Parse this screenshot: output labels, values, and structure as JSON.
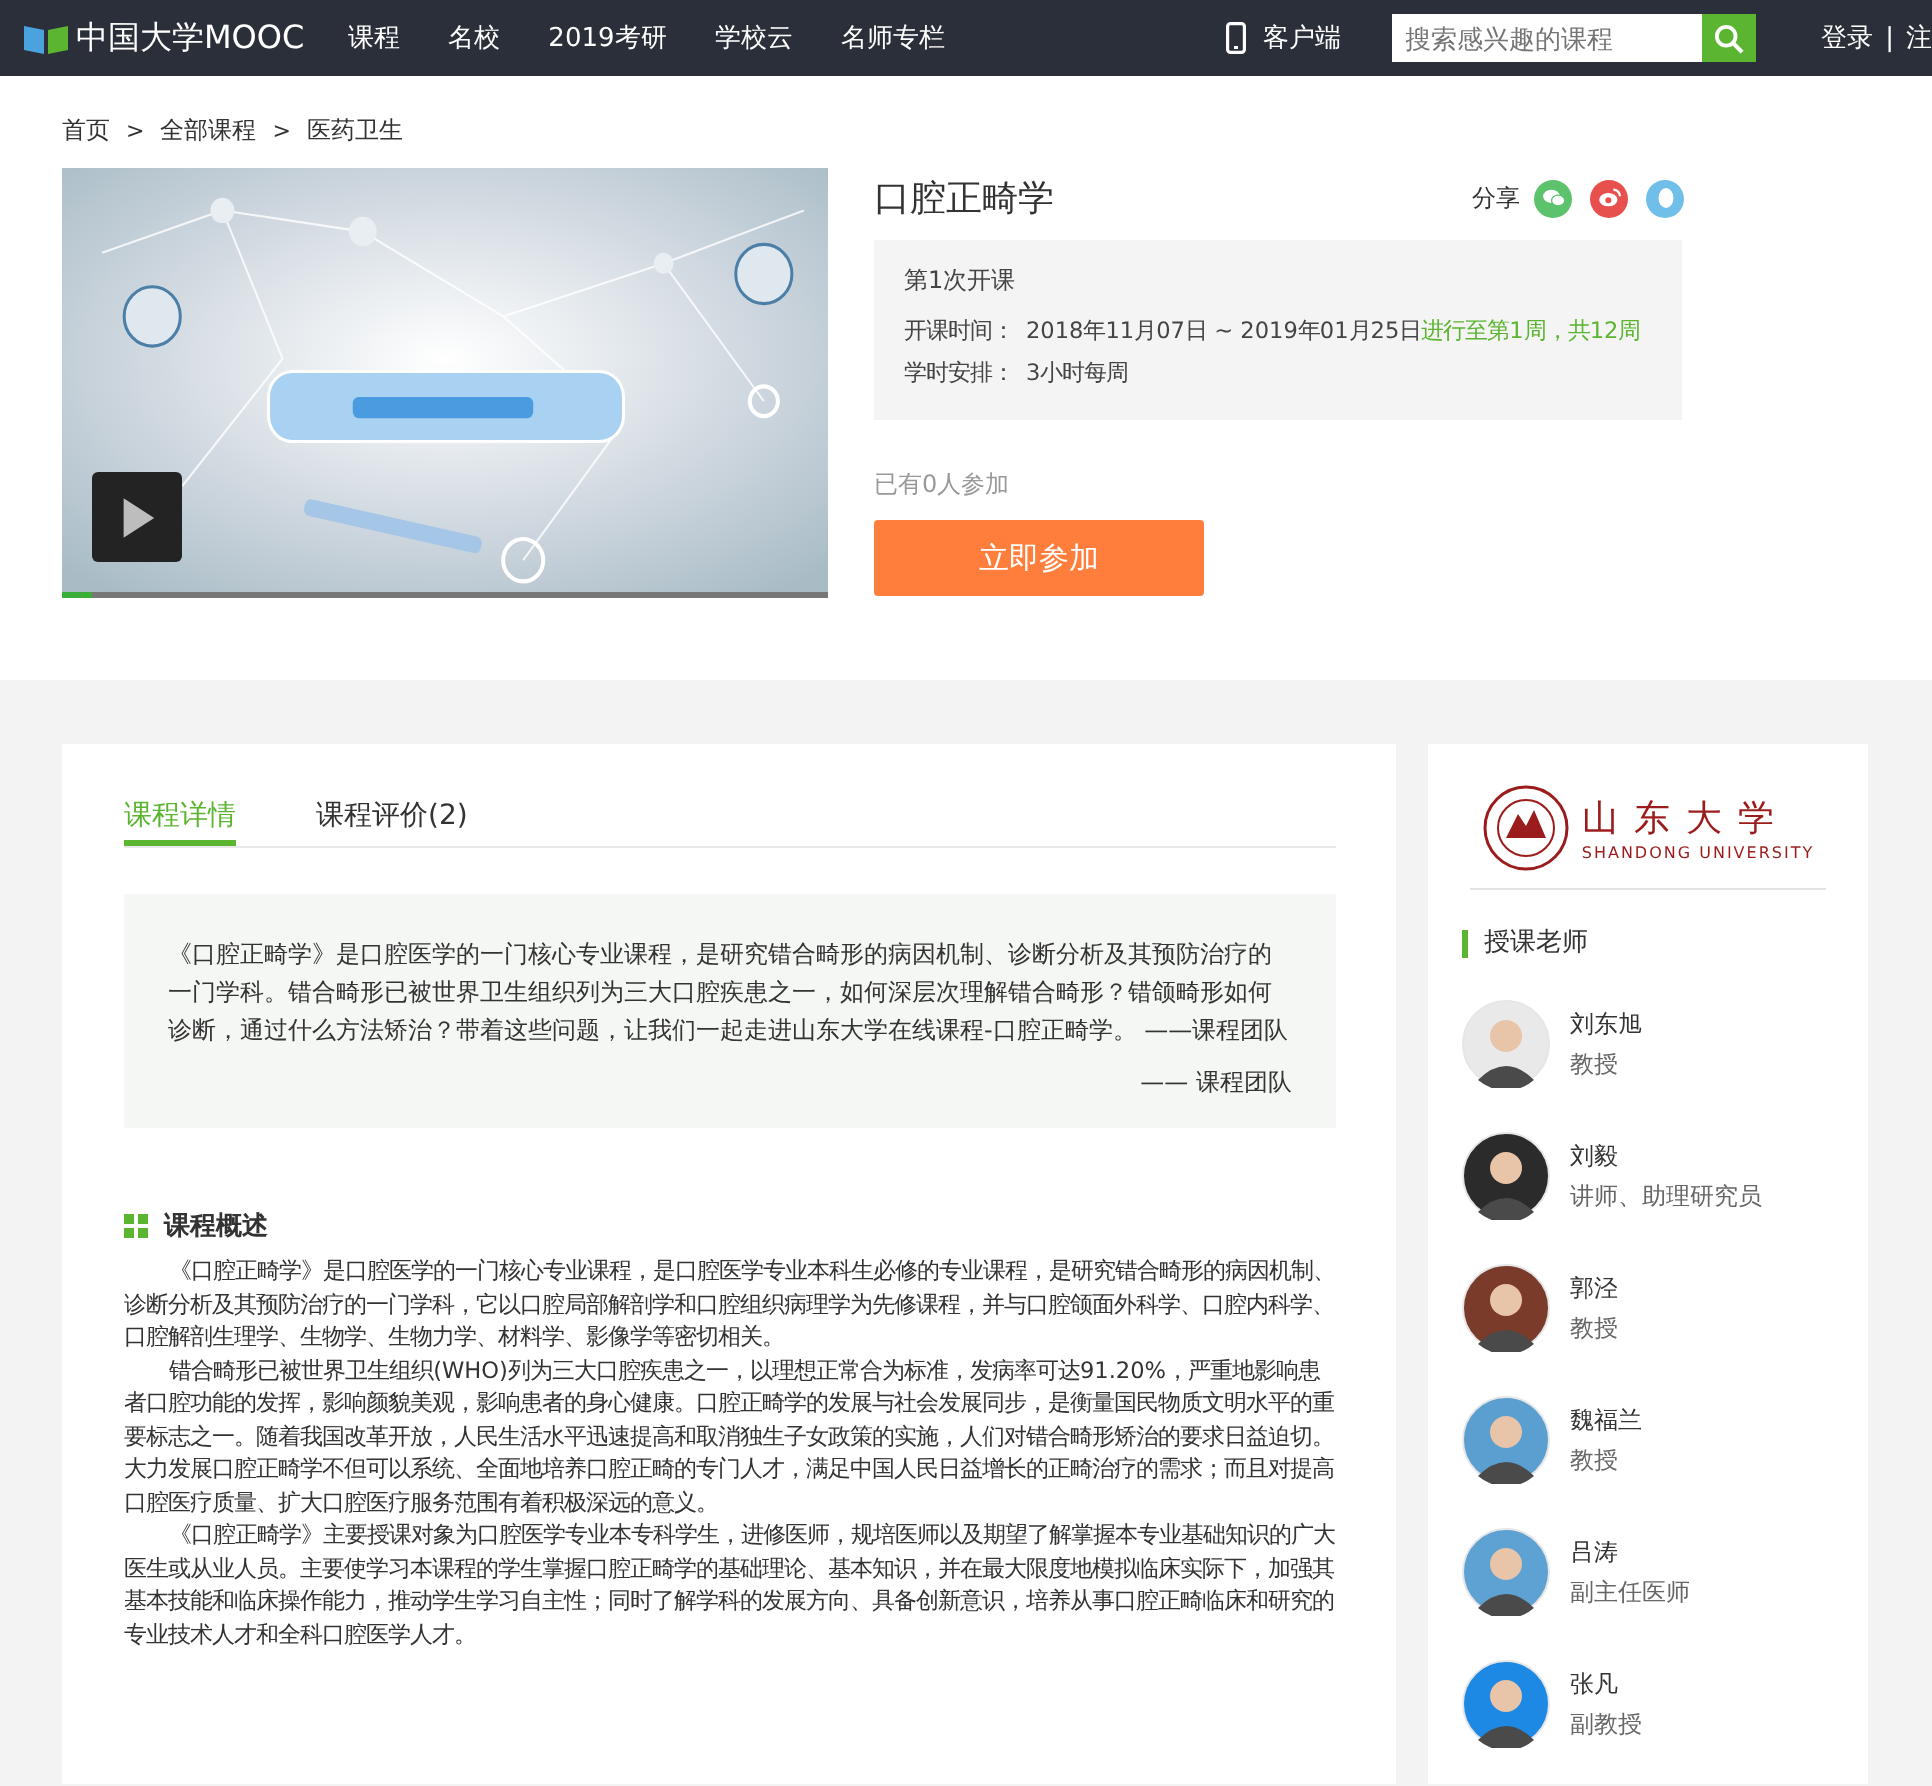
{
  "header": {
    "logo": "中国大学MOOC",
    "nav": [
      {
        "label": "课程"
      },
      {
        "label": "名校"
      },
      {
        "label": "2019考研"
      },
      {
        "label": "学校云"
      },
      {
        "label": "名师专栏"
      }
    ],
    "app_link": "客户端",
    "search": {
      "placeholder": "搜索感兴趣的课程"
    },
    "login": "登录",
    "separator": "|",
    "register": "注"
  },
  "breadcrumb": {
    "items": [
      "首页",
      "全部课程",
      "医药卫生"
    ],
    "separators": [
      ">",
      ">"
    ]
  },
  "video": {
    "progress": {
      "level": 0.04
    }
  },
  "course": {
    "title": "口腔正畸学",
    "share_label": "分享",
    "term": "第1次开课",
    "schedule": [
      {
        "label": "开课时间：",
        "value": "2018年11月07日 ~ 2019年01月25日",
        "status": "进行至第1周，共12周"
      },
      {
        "label": "学时安排：",
        "value": "3小时每周"
      }
    ],
    "enrolled": "已有0人参加",
    "join_button": "立即参加"
  },
  "tabs": [
    {
      "label": "课程详情",
      "selected": true
    },
    {
      "label": "课程评价(2)",
      "selected": false
    }
  ],
  "intro": {
    "text": "《口腔正畸学》是口腔医学的一门核心专业课程，是研究错合畸形的病因机制、诊断分析及其预防治疗的一门学科。错合畸形已被世界卫生组织列为三大口腔疾患之一，如何深层次理解错合畸形？错颌畸形如何诊断，通过什么方法矫治？带着这些问题，让我们一起走进山东大学在线课程-口腔正畸学。 ——课程团队",
    "signature": "—— 课程团队"
  },
  "overview": {
    "heading": "课程概述",
    "paragraphs": [
      "《口腔正畸学》是口腔医学的一门核心专业课程，是口腔医学专业本科生必修的专业课程，是研究错合畸形的病因机制、诊断分析及其预防治疗的一门学科，它以口腔局部解剖学和口腔组织病理学为先修课程，并与口腔颌面外科学、口腔内科学、口腔解剖生理学、生物学、生物力学、材料学、影像学等密切相关。",
      "错合畸形已被世界卫生组织(WHO)列为三大口腔疾患之一，以理想正常合为标准，发病率可达91.20%，严重地影响患者口腔功能的发挥，影响颜貌美观，影响患者的身心健康。口腔正畸学的发展与社会发展同步，是衡量国民物质文明水平的重要标志之一。随着我国改革开放，人民生活水平迅速提高和取消独生子女政策的实施，人们对错合畸形矫治的要求日益迫切。大力发展口腔正畸学不但可以系统、全面地培养口腔正畸的专门人才，满足中国人民日益增长的正畸治疗的需求；而且对提高口腔医疗质量、扩大口腔医疗服务范围有着积极深远的意义。",
      "《口腔正畸学》主要授课对象为口腔医学专业本专科学生，进修医师，规培医师以及期望了解掌握本专业基础知识的广大医生或从业人员。主要使学习本课程的学生掌握口腔正畸学的基础理论、基本知识，并在最大限度地模拟临床实际下，加强其基本技能和临床操作能力，推动学生学习自主性；同时了解学科的发展方向、具备创新意识，培养从事口腔正畸临床和研究的专业技术人才和全科口腔医学人才。"
    ]
  },
  "sidebar": {
    "university": {
      "calligraphy": "山东大学",
      "name": "SHANDONG UNIVERSITY"
    },
    "teachers_heading": "授课老师",
    "teachers": [
      {
        "name": "刘东旭",
        "title": "教授"
      },
      {
        "name": "刘毅",
        "title": "讲师、助理研究员"
      },
      {
        "name": "郭泾",
        "title": "教授"
      },
      {
        "name": "魏福兰",
        "title": "教授"
      },
      {
        "name": "吕涛",
        "title": "副主任医师"
      },
      {
        "name": "张凡",
        "title": "副教授"
      }
    ]
  }
}
